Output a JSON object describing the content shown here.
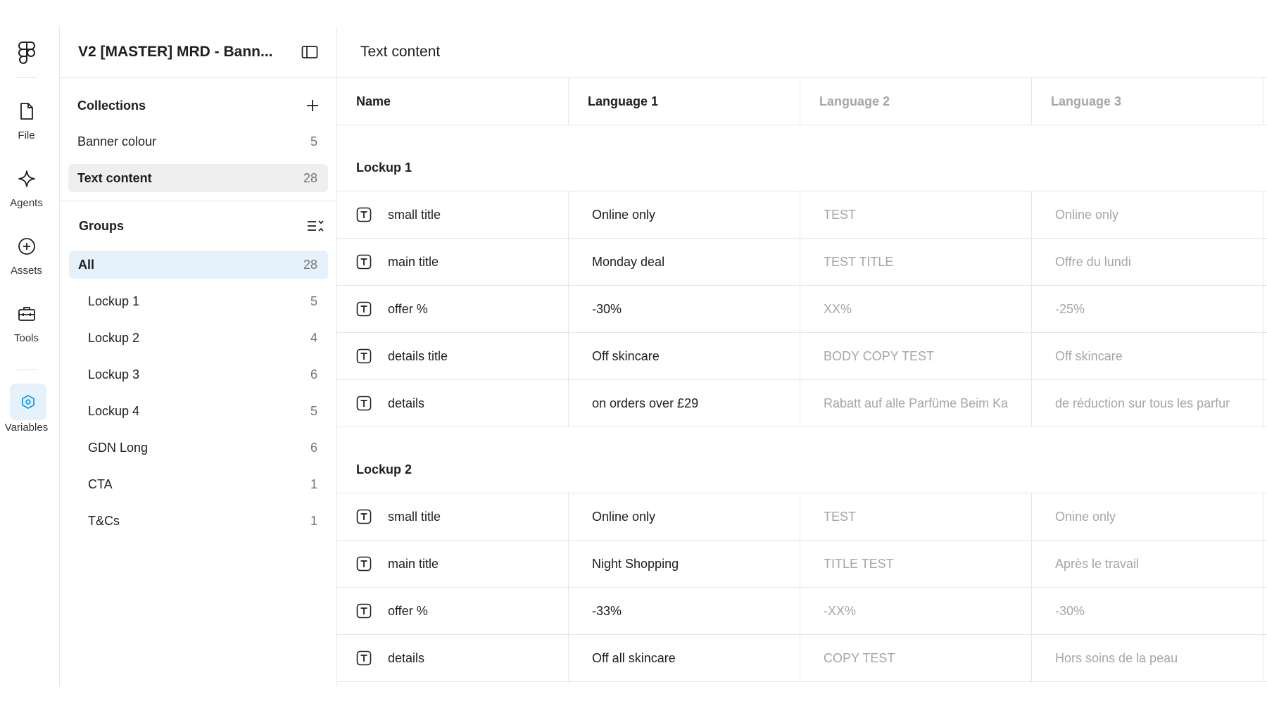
{
  "rail": {
    "items": [
      {
        "label": "File",
        "icon": "file-icon"
      },
      {
        "label": "Agents",
        "icon": "sparkle-icon"
      },
      {
        "label": "Assets",
        "icon": "plus-circle-icon"
      },
      {
        "label": "Tools",
        "icon": "toolbox-icon"
      },
      {
        "label": "Variables",
        "icon": "variables-icon"
      }
    ]
  },
  "panel": {
    "file_title": "V2 [MASTER] MRD - Bann...",
    "collections_title": "Collections",
    "collections": [
      {
        "label": "Banner colour",
        "count": "5"
      },
      {
        "label": "Text content",
        "count": "28"
      }
    ],
    "groups_title": "Groups",
    "groups": [
      {
        "label": "All",
        "count": "28"
      },
      {
        "label": "Lockup 1",
        "count": "5"
      },
      {
        "label": "Lockup 2",
        "count": "4"
      },
      {
        "label": "Lockup 3",
        "count": "6"
      },
      {
        "label": "Lockup 4",
        "count": "5"
      },
      {
        "label": "GDN Long",
        "count": "6"
      },
      {
        "label": "CTA",
        "count": "1"
      },
      {
        "label": "T&Cs",
        "count": "1"
      }
    ]
  },
  "main": {
    "title": "Text content",
    "columns": [
      "Name",
      "Language 1",
      "Language 2",
      "Language 3"
    ],
    "groups": [
      {
        "title": "Lockup 1",
        "rows": [
          {
            "name": "small title",
            "l1": "Online only",
            "l2": "TEST",
            "l3": "Online only"
          },
          {
            "name": "main title",
            "l1": "Monday deal",
            "l2": "TEST TITLE",
            "l3": "Offre du lundi"
          },
          {
            "name": "offer %",
            "l1": "-30%",
            "l2": "XX%",
            "l3": "-25%"
          },
          {
            "name": "details title",
            "l1": "Off skincare",
            "l2": "BODY COPY TEST",
            "l3": "Off skincare"
          },
          {
            "name": "details",
            "l1": "on orders over £29",
            "l2": "Rabatt auf alle Parfüme Beim Ka",
            "l3": "de réduction sur tous les parfur"
          }
        ]
      },
      {
        "title": "Lockup 2",
        "rows": [
          {
            "name": "small title",
            "l1": "Online only",
            "l2": "TEST",
            "l3": "Onine only"
          },
          {
            "name": "main title",
            "l1": "Night Shopping",
            "l2": "TITLE TEST",
            "l3": "Après le travail"
          },
          {
            "name": "offer %",
            "l1": "-33%",
            "l2": "-XX%",
            "l3": "-30%"
          },
          {
            "name": "details",
            "l1": "Off all skincare",
            "l2": "COPY TEST",
            "l3": "Hors soins de la peau"
          }
        ]
      }
    ]
  },
  "colors": {
    "selected_group_bg": "#e5f1fb",
    "selected_collection_bg": "#efefef",
    "accent": "#0d99ff"
  }
}
